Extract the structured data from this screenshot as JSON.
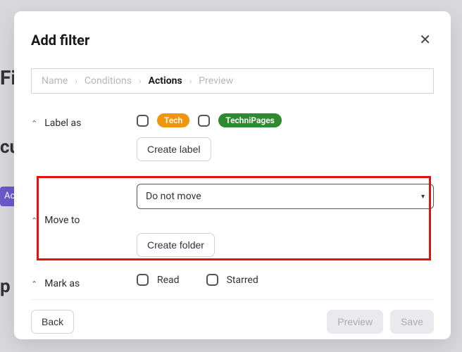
{
  "modal": {
    "title": "Add filter",
    "close_aria": "Close"
  },
  "breadcrumb": {
    "name": "Name",
    "conditions": "Conditions",
    "actions": "Actions",
    "preview": "Preview"
  },
  "labelas": {
    "title": "Label as",
    "tags": {
      "tech": "Tech",
      "technipages": "TechniPages"
    },
    "create": "Create label"
  },
  "moveto": {
    "title": "Move to",
    "select_value": "Do not move",
    "create": "Create folder"
  },
  "markas": {
    "title": "Mark as",
    "read": "Read",
    "starred": "Starred"
  },
  "footer": {
    "back": "Back",
    "preview": "Preview",
    "save": "Save"
  }
}
